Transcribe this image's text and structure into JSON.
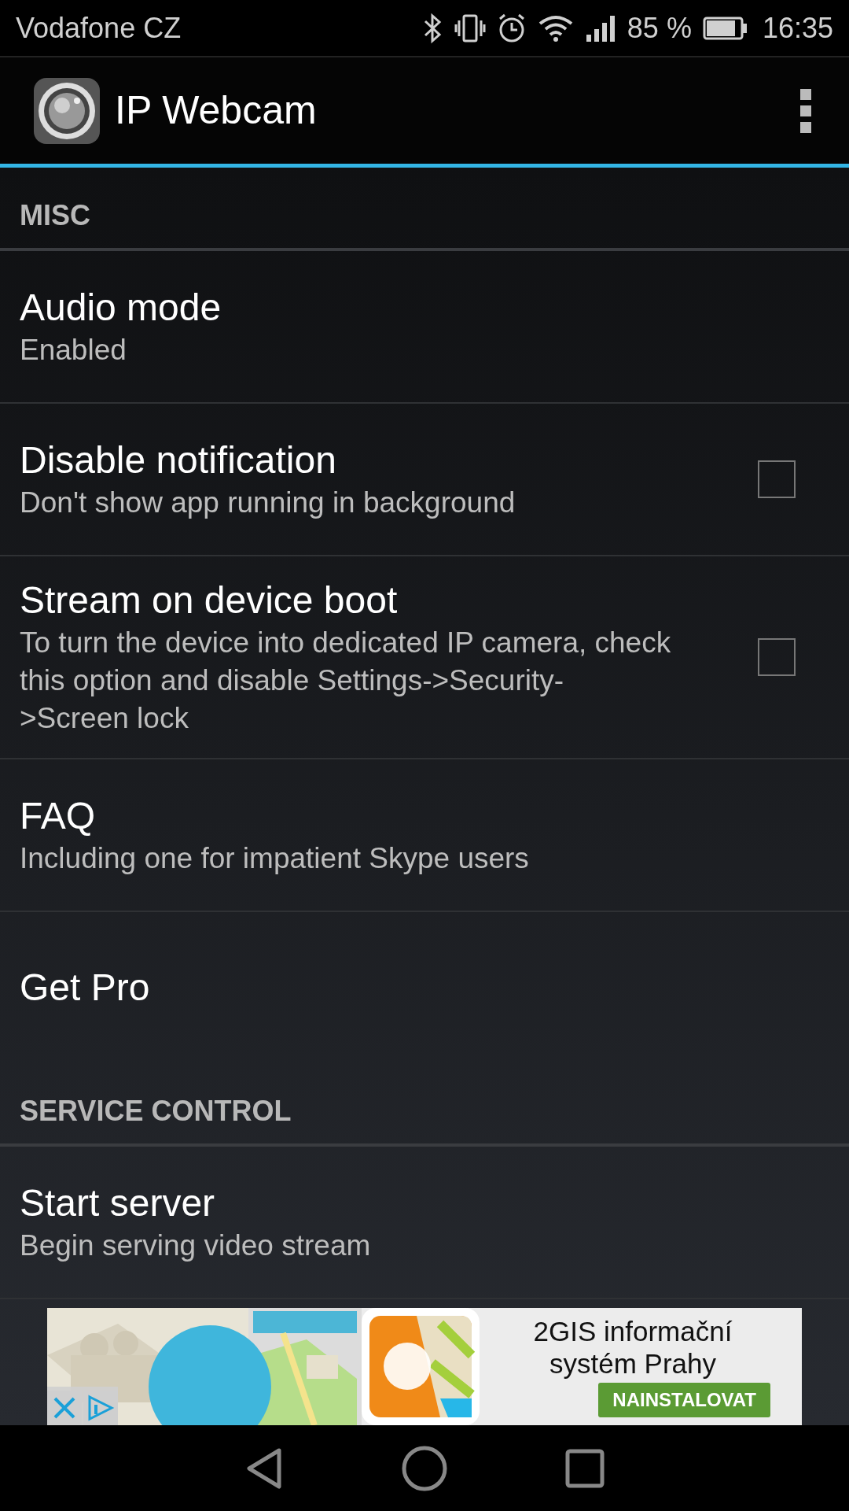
{
  "status_bar": {
    "carrier": "Vodafone CZ",
    "battery": "85 %",
    "time": "16:35"
  },
  "app_bar": {
    "title": "IP Webcam"
  },
  "settings": [
    {
      "kind": "header",
      "title": "MISC"
    },
    {
      "kind": "item",
      "title": "Audio mode",
      "summary": "Enabled"
    },
    {
      "kind": "checkbox",
      "title": "Disable notification",
      "summary": "Don't show app running in background",
      "checked": false
    },
    {
      "kind": "checkbox",
      "title": "Stream on device boot",
      "summary": "To turn the device into dedicated IP camera, check this option and disable Settings->Security->Screen lock",
      "checked": false
    },
    {
      "kind": "item",
      "title": "FAQ",
      "summary": "Including one for impatient Skype users"
    },
    {
      "kind": "item",
      "title": "Get Pro"
    },
    {
      "kind": "header",
      "title": "SERVICE CONTROL"
    },
    {
      "kind": "item",
      "title": "Start server",
      "summary": "Begin serving video stream"
    }
  ],
  "ad": {
    "title": "2GIS informační systém Prahy",
    "button": "NAINSTALOVAT"
  }
}
